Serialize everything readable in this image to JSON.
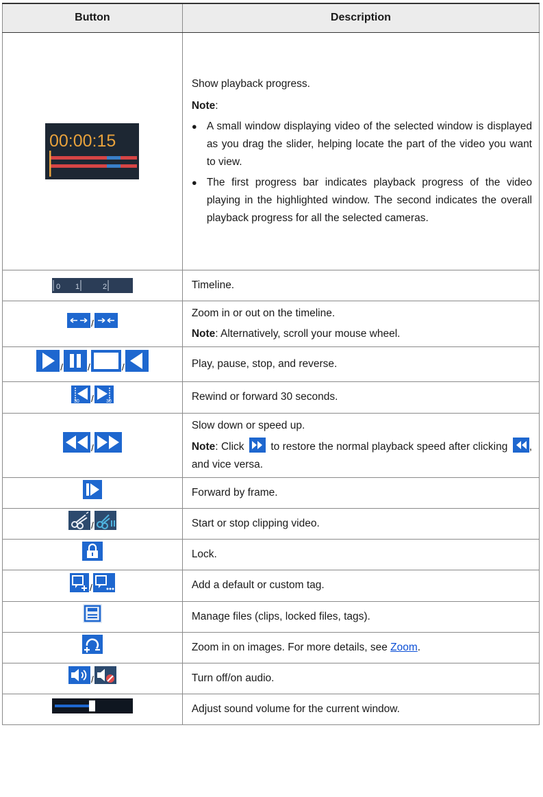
{
  "table": {
    "headers": {
      "button": "Button",
      "description": "Description"
    },
    "progress_row": {
      "timecode": "00:00:15",
      "line1": "Show playback progress.",
      "note_label": "Note",
      "note_colon": ":",
      "bullets": [
        "A small window displaying video of the selected window is displayed as you drag the slider, helping locate the part of the video you want to view.",
        "The first progress bar indicates playback progress of the video playing in the highlighted window. The second indicates the overall playback progress for all the selected cameras."
      ]
    },
    "timeline_row": {
      "ticks": [
        "0",
        "1",
        "2"
      ],
      "text": "Timeline."
    },
    "zoom_row": {
      "sep": "/",
      "line1": "Zoom in or out on the timeline.",
      "note_label": "Note",
      "note_text": ": Alternatively, scroll your mouse wheel."
    },
    "play_row": {
      "sep": "/",
      "text": "Play, pause, stop, and reverse."
    },
    "skip_row": {
      "sep": "/",
      "icon_digits": "30",
      "text": "Rewind or forward 30 seconds."
    },
    "speed_row": {
      "sep": "/",
      "line1": "Slow down or speed up.",
      "note_label": "Note",
      "note_a": ": Click",
      "note_b": "to restore the normal playback speed after clicking",
      "note_c": ", and vice versa."
    },
    "frame_row": {
      "text": "Forward by frame."
    },
    "clip_row": {
      "sep": "/",
      "text": "Start or stop clipping video."
    },
    "lock_row": {
      "text": "Lock."
    },
    "tag_row": {
      "sep": "/",
      "text": "Add a default or custom tag."
    },
    "files_row": {
      "text": "Manage files (clips, locked files, tags)."
    },
    "imgzoom_row": {
      "text_a": "Zoom in on images. For more details, see ",
      "link": "Zoom",
      "text_b": "."
    },
    "audio_row": {
      "sep": "/",
      "text": "Turn off/on audio."
    },
    "volume_row": {
      "text": "Adjust sound volume for the current window.",
      "level": 0.45
    }
  },
  "colors": {
    "icon_blue": "#1e67cf",
    "icon_dark": "#1d2a3a",
    "progress_red": "#d64545",
    "progress_blue": "#3a7fc8",
    "timecode_orange": "#e8a23c",
    "link": "#0b4fd6"
  }
}
